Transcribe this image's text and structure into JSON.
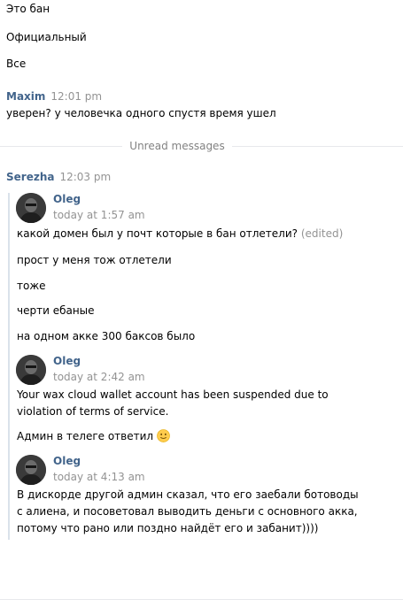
{
  "messages_top": [
    {
      "text": "Это бан"
    },
    {
      "text": "Официальный"
    },
    {
      "text": "Все"
    }
  ],
  "maxim": {
    "author": "Maxim",
    "time": "12:01 pm",
    "text": "уверен? у человечка одного спустя время ушел"
  },
  "divider": {
    "label": "Unread messages"
  },
  "serezha": {
    "author": "Serezha",
    "time": "12:03 pm"
  },
  "forwarded": [
    {
      "author": "Oleg",
      "time": "today at 1:57 am",
      "lines": [
        {
          "text": "какой домен был у почт которые в бан отлетели?",
          "edited": "(edited)"
        },
        {
          "text": "прост у меня тож отлетели"
        },
        {
          "text": "тоже"
        },
        {
          "text": "черти ебаные"
        },
        {
          "text": "на одном акке 300 баксов было"
        }
      ]
    },
    {
      "author": "Oleg",
      "time": "today at 2:42 am",
      "lines": [
        {
          "text": "Your wax cloud wallet account has been suspended due to"
        },
        {
          "text": "violation of terms of service."
        },
        {
          "text": "Админ в телеге ответил",
          "emoji": "slightly-smiling-face-emoji"
        }
      ]
    },
    {
      "author": "Oleg",
      "time": "today at 4:13 am",
      "lines": [
        {
          "text": "В дискорде другой админ сказал, что его заебали ботоводы"
        },
        {
          "text": "с алиена, и посоветовал выводить деньги с основного акка,"
        },
        {
          "text": "потому что рано или поздно найдёт его и забанит))))"
        }
      ]
    }
  ],
  "colors": {
    "author": "#42648b",
    "meta": "#939393",
    "divider_line": "#e7e8ec",
    "forward_bar": "#dae2ea",
    "emoji_fill": "#ffcc4d"
  }
}
